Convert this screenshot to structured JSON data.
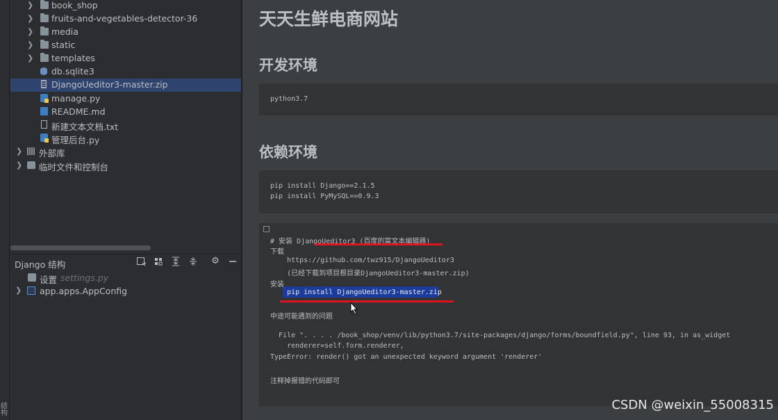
{
  "project_tree": [
    {
      "label": "book_shop",
      "type": "folder",
      "expandable": true
    },
    {
      "label": "fruits-and-vegetables-detector-36",
      "type": "folder",
      "expandable": true
    },
    {
      "label": "media",
      "type": "folder",
      "expandable": true
    },
    {
      "label": "static",
      "type": "folder",
      "expandable": true
    },
    {
      "label": "templates",
      "type": "folder",
      "expandable": true
    },
    {
      "label": "db.sqlite3",
      "type": "db",
      "expandable": false
    },
    {
      "label": "DjangoUeditor3-master.zip",
      "type": "zip",
      "expandable": false,
      "selected": true
    },
    {
      "label": "manage.py",
      "type": "py",
      "expandable": false
    },
    {
      "label": "README.md",
      "type": "md",
      "expandable": false
    },
    {
      "label": "新建文本文档.txt",
      "type": "txt",
      "expandable": false
    },
    {
      "label": "管理后台.py",
      "type": "py",
      "expandable": false
    },
    {
      "label": "外部库",
      "type": "lib",
      "expandable": true
    },
    {
      "label": "临时文件和控制台",
      "type": "console",
      "expandable": true
    }
  ],
  "structure": {
    "title": "Django 结构",
    "items": [
      {
        "label": "设置",
        "hint": "settings.py"
      },
      {
        "label": "app.apps.AppConfig",
        "hint": ""
      }
    ]
  },
  "preview": {
    "title": "天天生鲜电商网站",
    "section1": "开发环境",
    "code1": [
      "python3.7"
    ],
    "section2": "依赖环境",
    "code2": [
      "pip install Django==2.1.5",
      "pip install PyMySQL==0.9.3"
    ],
    "code3": [
      "# 安装 DjangoUeditor3 (百度的富文本编辑器)",
      "下载",
      "    https://github.com/twz915/DjangoUeditor3",
      "    (已经下载到项目根目录DjangoUeditor3-master.zip)",
      "安装",
      "    pip install DjangoUeditor3-master.zip",
      "",
      "中途可能遇到的问题",
      "",
      "  File \". . . . /book_shop/venv/lib/python3.7/site-packages/django/forms/boundfield.py\", line 93, in as_widget",
      "    renderer=self.form.renderer,",
      "TypeError: render() got an unexpected keyword argument 'renderer'",
      "",
      "注释掉报错的代码即可"
    ]
  },
  "left_strip_text": "结构",
  "watermark": "CSDN @weixin_55008315"
}
